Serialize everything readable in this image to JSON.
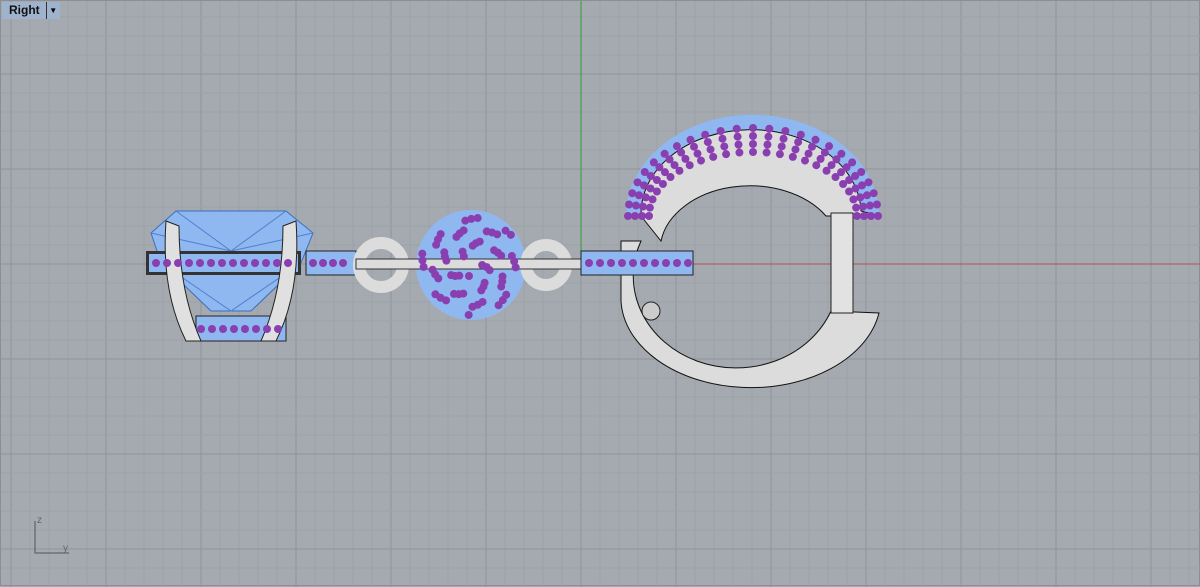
{
  "viewport": {
    "name": "Right",
    "dropdown_icon": "triangle-down"
  },
  "axis_widget": {
    "vertical": "z",
    "horizontal": "y"
  },
  "colors": {
    "background": "#a5aab1",
    "grid_minor": "#9aa0a7",
    "grid_major": "#8e949b",
    "x_axis": "#b05050",
    "z_axis": "#30a030",
    "gem": "#8fb8f0",
    "stone": "#8a3fb0",
    "metal": "#dcdcdc"
  }
}
